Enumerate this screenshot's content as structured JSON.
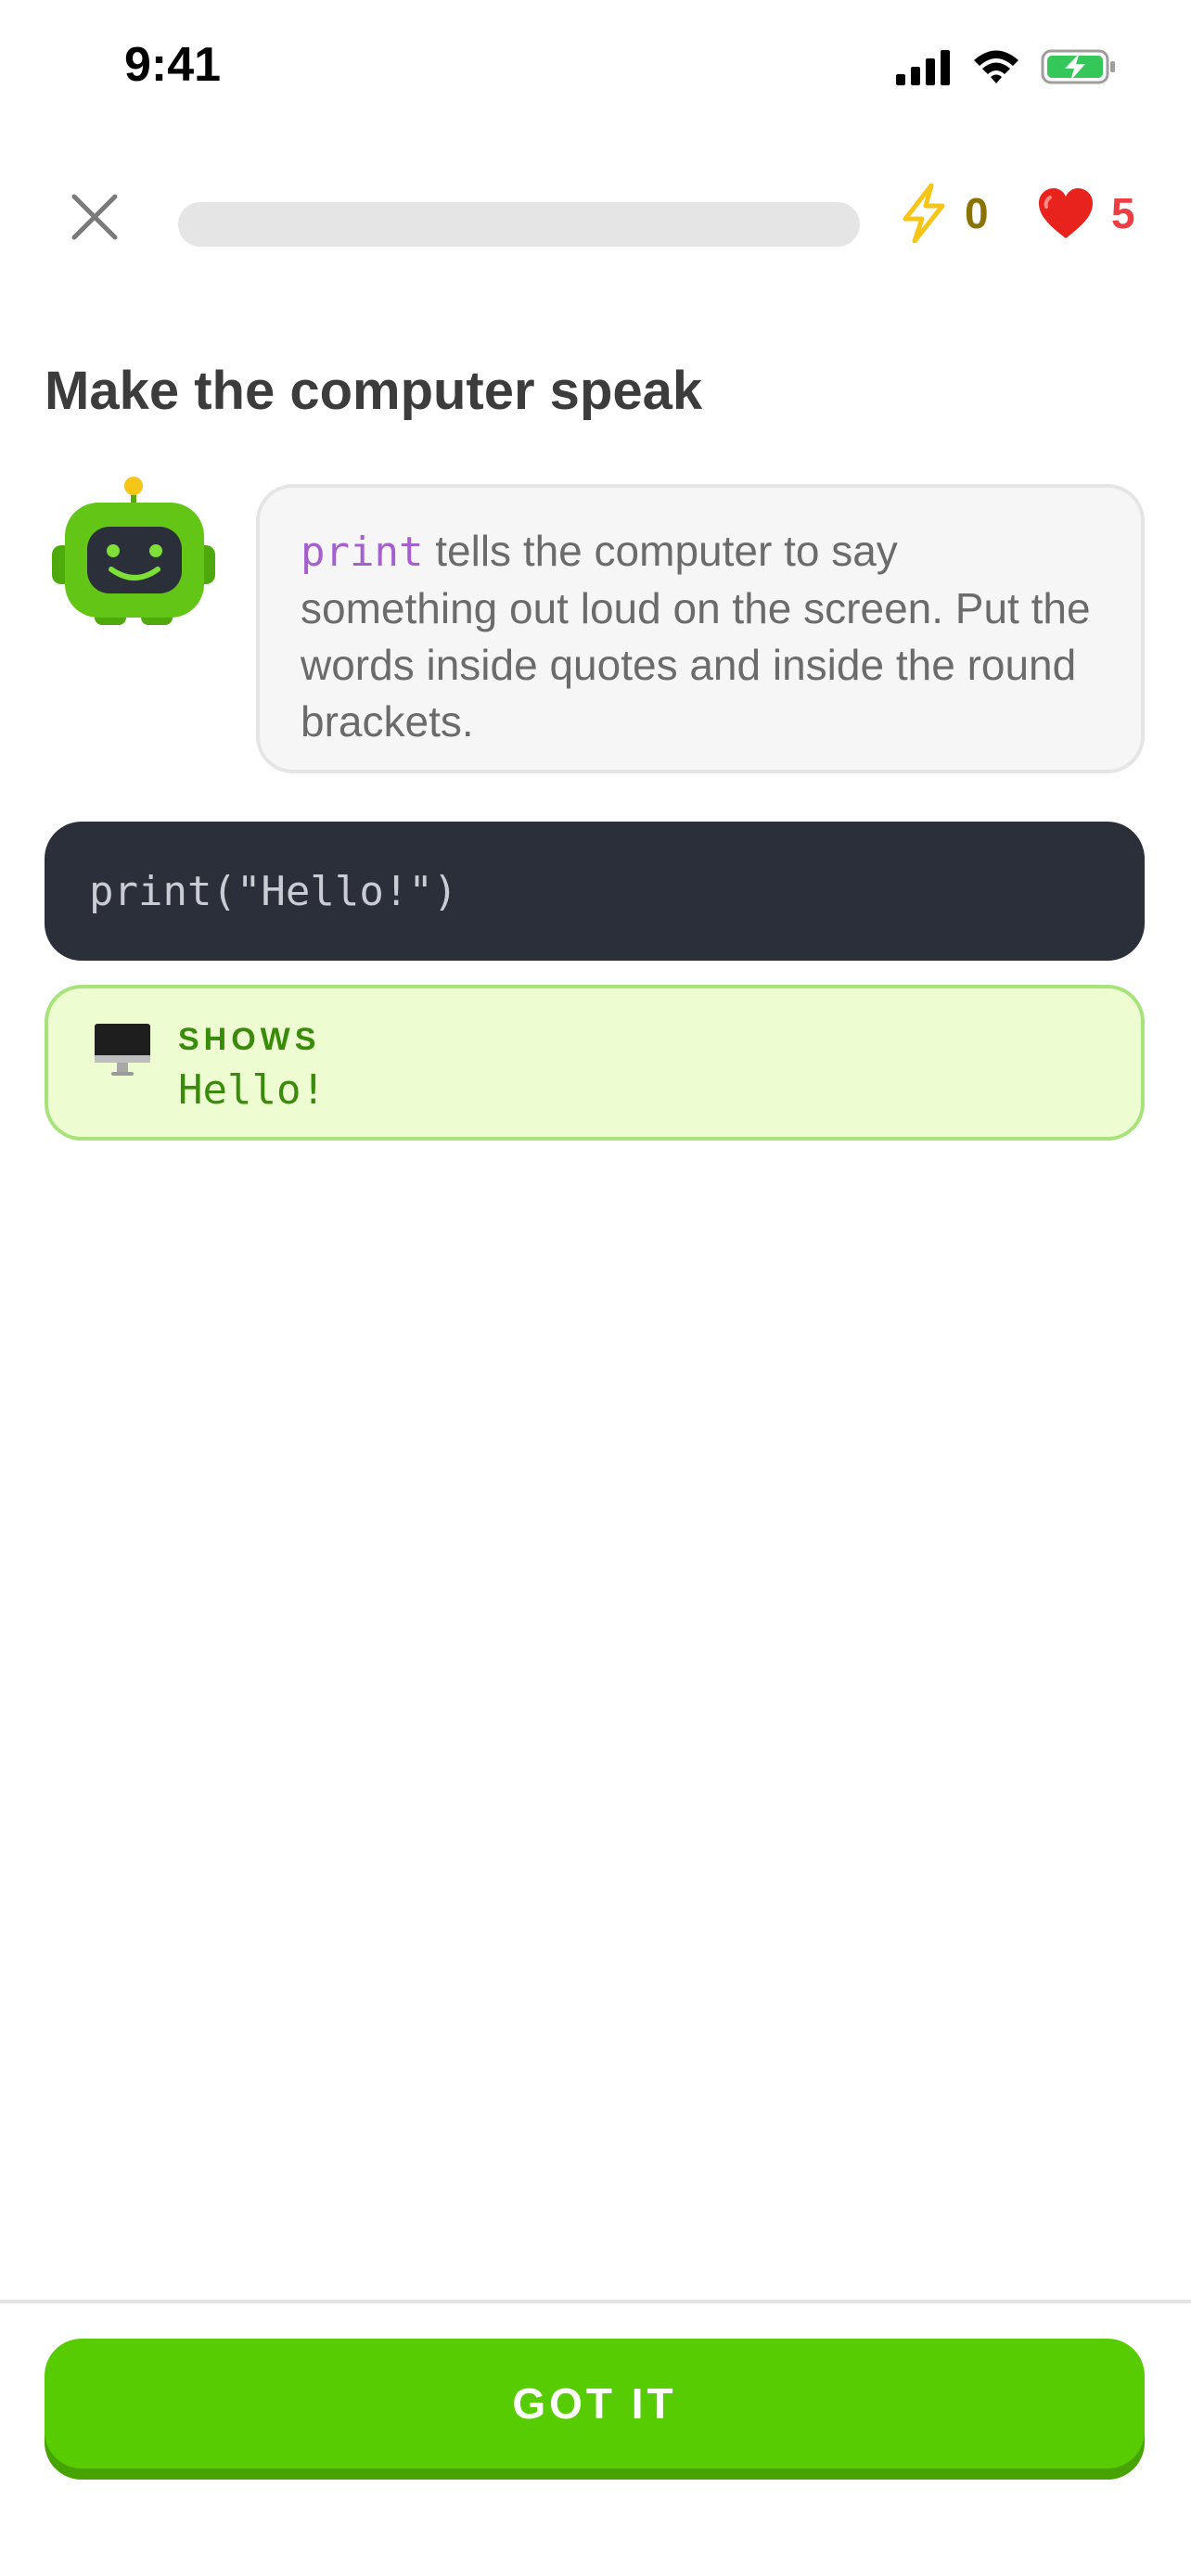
{
  "status_bar": {
    "time": "9:41"
  },
  "header": {
    "progress_percent": 0,
    "energy_count": "0",
    "hearts_count": "5"
  },
  "lesson": {
    "title": "Make the computer speak",
    "explanation_keyword": "print",
    "explanation_text": " tells the computer to say something out loud on the screen. Put the words inside quotes and inside the round brackets.",
    "code": "print(\"Hello!\")",
    "output_label": "SHOWS",
    "output_value": "Hello!"
  },
  "footer": {
    "cta_label": "GOT IT"
  },
  "colors": {
    "brand_green": "#58cc02",
    "heart_red": "#ee3e44",
    "keyword_purple": "#a560d0",
    "code_bg": "#2b2f3a",
    "output_bg": "#eefcd2"
  },
  "icons": {
    "close": "close-icon",
    "energy": "lightning-icon",
    "hearts": "heart-icon",
    "mascot": "robot-mascot-icon",
    "output": "monitor-icon"
  }
}
